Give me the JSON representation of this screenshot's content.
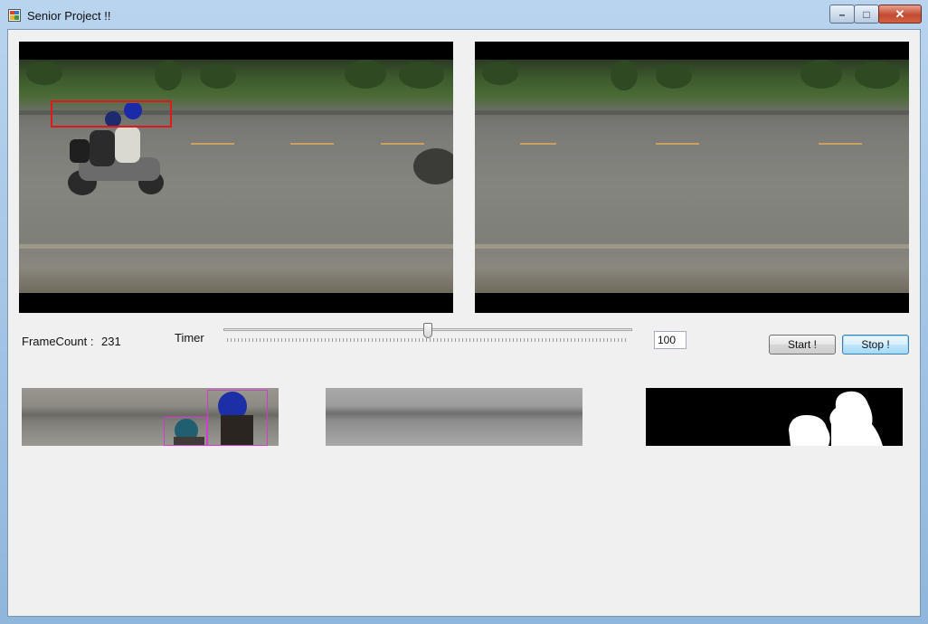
{
  "window": {
    "title": "Senior Project !!",
    "caption_buttons": {
      "minimize": "–",
      "maximize": "□",
      "close": "✕"
    }
  },
  "controls": {
    "frame_count_label": "FrameCount :",
    "frame_count_value": "231",
    "timer_label": "Timer",
    "timer_slider_level": 0.5,
    "timer_value": "100",
    "start_button": "Start !",
    "stop_button": "Stop !"
  },
  "icons": {
    "app_icon": "app-window-icon",
    "minimize": "minimize-icon",
    "maximize": "maximize-icon",
    "close": "close-icon"
  },
  "colors": {
    "detection_box": "#e01818",
    "helmet_box": "#d23ad2",
    "title_bar": "#a9c8e8"
  }
}
